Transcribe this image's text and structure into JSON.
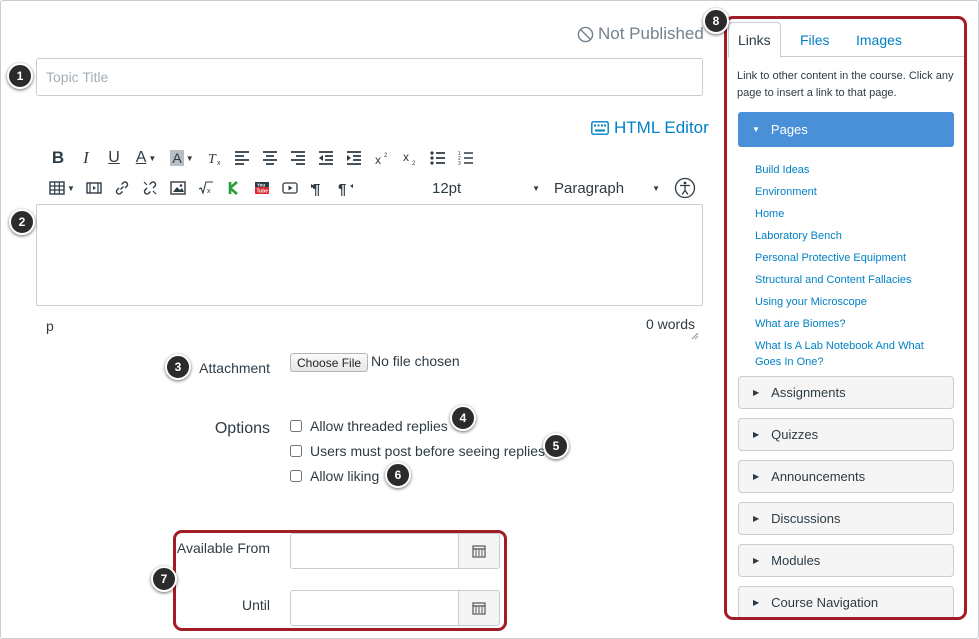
{
  "status": {
    "label": "Not Published"
  },
  "topic": {
    "placeholder": "Topic Title",
    "value": ""
  },
  "editor": {
    "html_editor_label": "HTML Editor",
    "font_size": "12pt",
    "block_format": "Paragraph",
    "path": "p",
    "word_count": "0 words"
  },
  "attachment": {
    "label": "Attachment",
    "button": "Choose File",
    "status": "No file chosen"
  },
  "options": {
    "label": "Options",
    "items": [
      {
        "label": "Allow threaded replies",
        "checked": false
      },
      {
        "label": "Users must post before seeing replies",
        "checked": false
      },
      {
        "label": "Allow liking",
        "checked": false
      }
    ]
  },
  "availability": {
    "from_label": "Available From",
    "until_label": "Until",
    "from_value": "",
    "until_value": ""
  },
  "callouts": [
    "1",
    "2",
    "3",
    "4",
    "5",
    "6",
    "7",
    "8"
  ],
  "callout_color": "#a11c24",
  "sidebar": {
    "tabs": [
      "Links",
      "Files",
      "Images"
    ],
    "active_tab": "Links",
    "description": "Link to other content in the course. Click any page to insert a link to that page.",
    "pages_header": "Pages",
    "pages": [
      "Build Ideas",
      "Environment",
      "Home",
      "Laboratory Bench",
      "Personal Protective Equipment",
      "Structural and Content Fallacies",
      "Using your Microscope",
      "What are Biomes?",
      "What Is A Lab Notebook And What Goes In One?"
    ],
    "sections": [
      "Assignments",
      "Quizzes",
      "Announcements",
      "Discussions",
      "Modules",
      "Course Navigation"
    ]
  },
  "colors": {
    "link": "#0081c4",
    "accent": "#4a90d9",
    "text": "#2d3b45"
  }
}
